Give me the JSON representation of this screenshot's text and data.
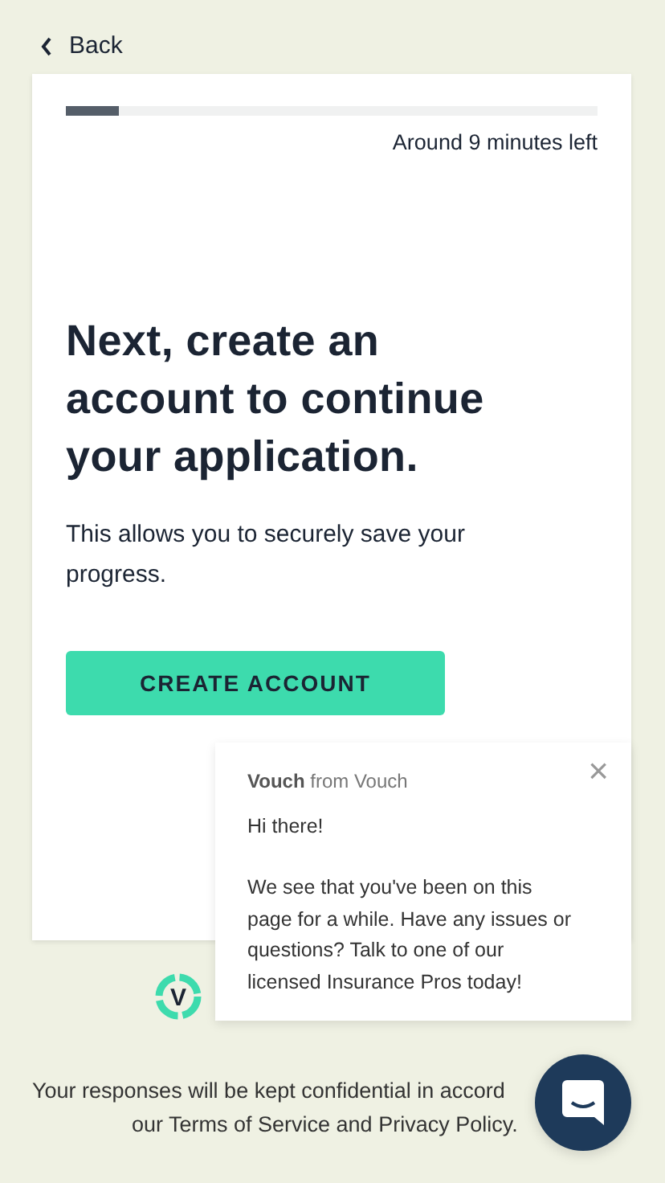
{
  "back": {
    "label": "Back"
  },
  "progress": {
    "level": 0.1,
    "reading": "Around 9 minutes left"
  },
  "heading": "Next, create an account to continue your application.",
  "body": "This allows you to securely save your progress.",
  "button": {
    "label": "CREATE ACCOUNT"
  },
  "chat_popup": {
    "sender": "**Vouch** from Vouch",
    "greeting": "Hi there!",
    "message": "We see that you've been on this page for a while. Have any issues or questions? Talk to one of our licensed Insurance Pros today!",
    "close": "×"
  },
  "logo_letter": "V",
  "footer": [
    "Your responses will be kept confidential in accord",
    "our Terms of Service and Privacy Policy."
  ]
}
